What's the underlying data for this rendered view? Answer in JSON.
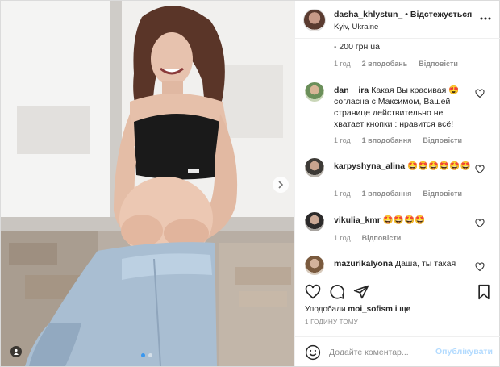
{
  "header": {
    "username": "dasha_khlystun_",
    "separator": "•",
    "follow_label": "Відстежується",
    "location": "Kyiv, Ukraine",
    "more_icon": "ellipsis-icon"
  },
  "caption_tail": "- 200 грн ua",
  "caption_meta": {
    "time": "1 год",
    "likes": "2 вподобань",
    "reply": "Відповісти"
  },
  "comments": [
    {
      "username": "dan__ira",
      "text": "Какая Вы красивая 😍 согласна с Максимом, Вашей странице действительно не хватает кнопки : нравится всё!",
      "time": "1 год",
      "likes": "1 вподобання",
      "reply": "Відповісти"
    },
    {
      "username": "karpyshyna_alina",
      "text": "🤩🤩🤩🤩🤩🤩",
      "time": "1 год",
      "likes": "1 вподобання",
      "reply": "Відповісти"
    },
    {
      "username": "vikulia_kmr",
      "text": "🤩🤩🤩🤩",
      "time": "1 год",
      "likes": "",
      "reply": "Відповісти"
    },
    {
      "username": "mazurikalyona",
      "text": "Даша, ты такая",
      "time": "",
      "likes": "",
      "reply": ""
    }
  ],
  "actions": {
    "like_icon": "heart-icon",
    "comment_icon": "comment-icon",
    "share_icon": "paper-plane-icon",
    "save_icon": "bookmark-icon"
  },
  "likes_line": {
    "prefix": "Уподобали",
    "user": "moi_sofism",
    "suffix": "і ще"
  },
  "timestamp": "1 ГОДИНУ ТОМУ",
  "add_comment": {
    "placeholder": "Додайте коментар...",
    "post_label": "Опублікувати",
    "emoji_icon": "smiley-icon"
  },
  "carousel": {
    "current": 1,
    "total": 2
  },
  "colors": {
    "link_blue": "#3897f0",
    "post_disabled": "#b3dbff",
    "muted": "#8e8e8e",
    "text": "#262626"
  }
}
